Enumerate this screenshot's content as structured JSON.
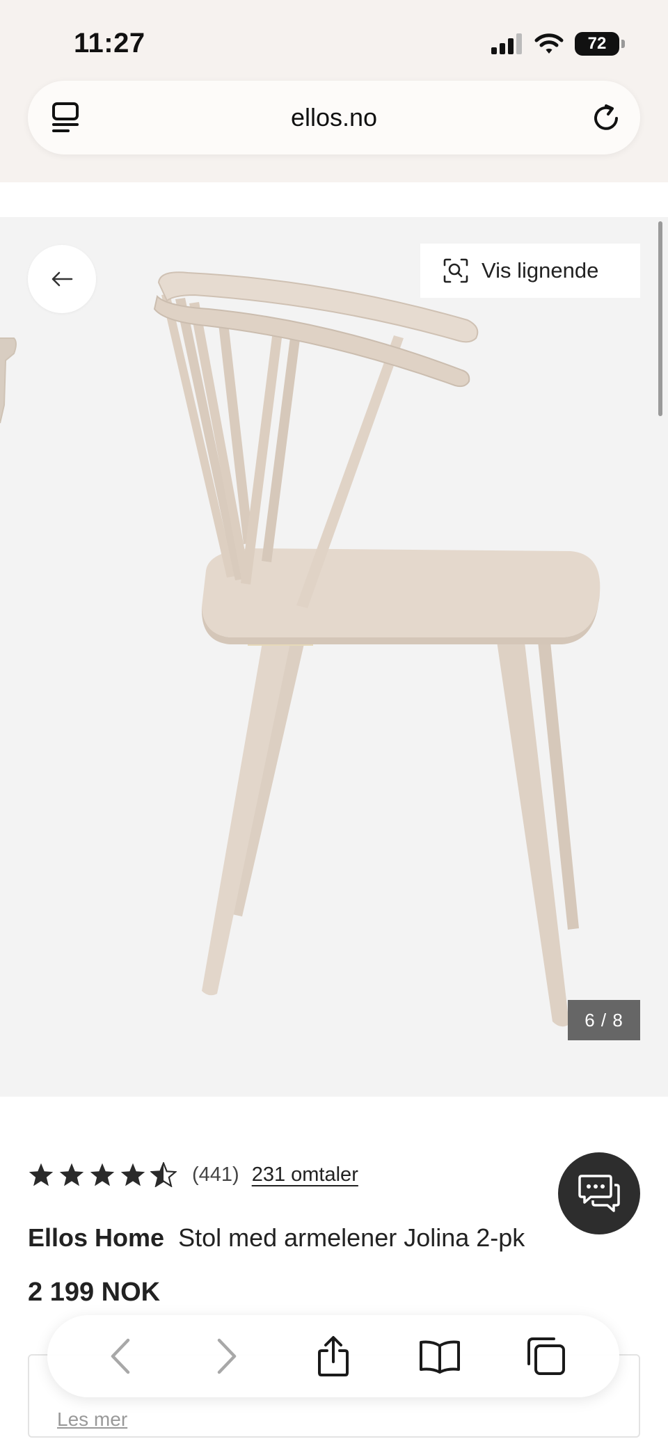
{
  "status_bar": {
    "time": "11:27",
    "battery": "72",
    "icons": [
      "cellular-signal-icon",
      "wifi-icon",
      "battery-icon"
    ]
  },
  "browser": {
    "url": "ellos.no",
    "left_icon": "tabs-overview-icon",
    "right_icon": "reload-icon"
  },
  "gallery": {
    "back_icon": "arrow-left-icon",
    "similar_label": "Vis lignende",
    "similar_icon": "visual-search-icon",
    "counter": "6 / 8",
    "background": "#f3f3f3"
  },
  "product": {
    "rating": 4.5,
    "rating_count": "(441)",
    "reviews_link": "231 omtaler",
    "brand": "Ellos Home",
    "name": "Stol med armelener Jolina 2-pk",
    "price": "2 199 NOK"
  },
  "finance": {
    "read_more": "Les mer"
  },
  "chat": {
    "icon": "chat-icon",
    "color": "#2d2d2d"
  },
  "toolbar": {
    "items": [
      "chevron-left-icon",
      "chevron-right-icon",
      "share-icon",
      "bookmarks-icon",
      "tabs-icon"
    ]
  },
  "colors": {
    "chrome_bg": "#f6f2ef",
    "text": "#222222"
  }
}
